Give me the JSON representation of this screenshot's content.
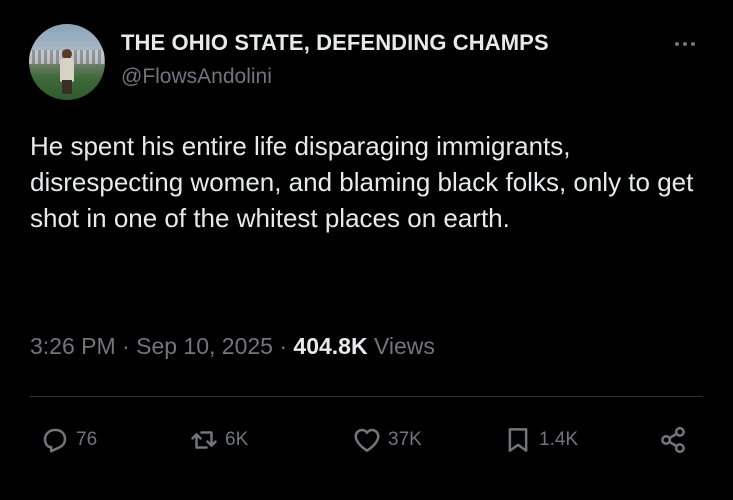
{
  "author": {
    "display_name": "THE OHIO STATE, DEFENDING CHAMPS",
    "handle": "@FlowsAndolini"
  },
  "tweet": {
    "text": "He spent his entire life disparaging immigrants, disrespecting women, and blaming black folks, only to get shot in one of the whitest places on earth.",
    "time": "3:26 PM",
    "separator": " · ",
    "date": "Sep 10, 2025",
    "views_count": "404.8K",
    "views_label": " Views"
  },
  "actions": {
    "replies": "76",
    "reposts": "6K",
    "likes": "37K",
    "bookmarks": "1.4K"
  },
  "icons": [
    "more-icon",
    "reply-icon",
    "repost-icon",
    "like-icon",
    "bookmark-icon",
    "share-icon"
  ],
  "colors": {
    "background": "#000000",
    "primary_text": "#e7e9ea",
    "secondary_text": "#71767b"
  }
}
